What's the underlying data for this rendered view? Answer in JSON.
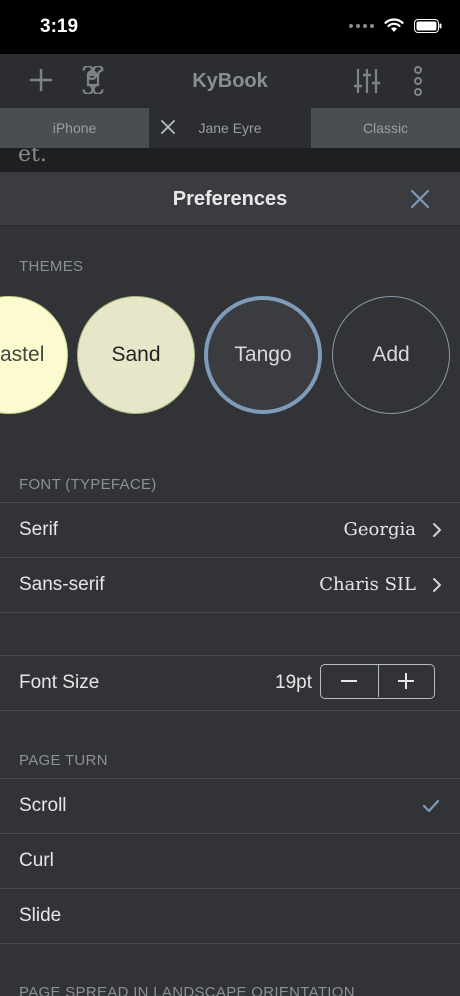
{
  "status": {
    "time": "3:19"
  },
  "app": {
    "title": "KyBook"
  },
  "tabs": {
    "left": "iPhone",
    "middle": "Jane Eyre",
    "right": "Classic"
  },
  "book": {
    "text_fragment": "et."
  },
  "preferences": {
    "title": "Preferences",
    "themes": {
      "label": "THEMES",
      "items": [
        "astel",
        "Sand",
        "Tango",
        "Add"
      ]
    },
    "font": {
      "label": "FONT (TYPEFACE)",
      "serif_label": "Serif",
      "serif_value": "Georgia",
      "sans_label": "Sans-serif",
      "sans_value": "Charis SIL"
    },
    "font_size": {
      "label": "Font Size",
      "value": "19pt"
    },
    "page_turn": {
      "label": "PAGE TURN",
      "options": [
        "Scroll",
        "Curl",
        "Slide"
      ],
      "selected": "Scroll"
    },
    "page_spread": {
      "label": "PAGE SPREAD IN LANDSCAPE ORIENTATION"
    }
  },
  "colors": {
    "accent": "#7e9bb8",
    "background": "#313336",
    "header": "#3a3c40",
    "pastel": "#fbfbcf",
    "sand": "#e8e6c9"
  }
}
